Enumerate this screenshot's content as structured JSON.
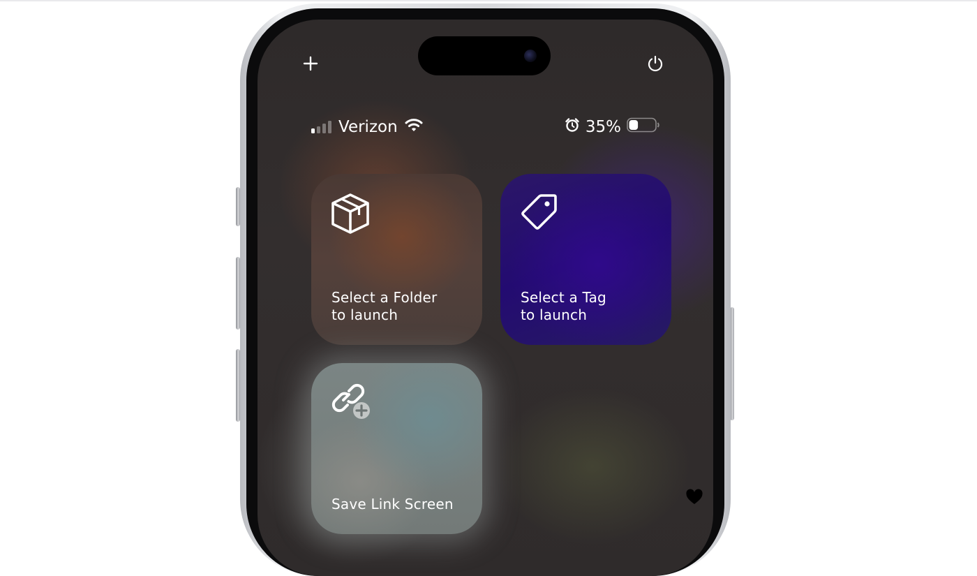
{
  "status_bar": {
    "carrier": "Verizon",
    "battery_percent": "35%",
    "battery_level": 0.35,
    "signal_bars_active": 1,
    "signal_bars_total": 4
  },
  "top_controls": {
    "add_icon": "plus-icon",
    "power_icon": "power-icon"
  },
  "tiles": [
    {
      "icon": "box-icon",
      "label": "Select a Folder\nto launch"
    },
    {
      "icon": "tag-icon",
      "label": "Select a Tag\nto launch"
    },
    {
      "icon": "link-add-icon",
      "label": "Save Link Screen"
    }
  ],
  "colors": {
    "tag_tile": "#230b71",
    "folder_tile": "#4f3c36",
    "link_tile": "#7a8483"
  }
}
